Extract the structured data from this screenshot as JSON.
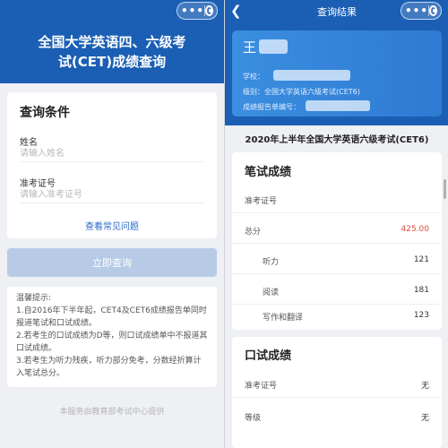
{
  "query_page": {
    "title_line1": "全国大学英语四、六级考",
    "title_line2": "试(CET)成绩查询",
    "section_title": "查询条件",
    "name_label": "姓名",
    "name_placeholder": "请输入姓名",
    "id_label": "准考证号",
    "id_placeholder": "请输入准考证号",
    "faq_link": "查看常见问题",
    "query_button": "立即查询",
    "tips": {
      "heading": "温馨提示:",
      "item1": "1.自2016年下半年起，CET4及CET6成绩报告单同时报道笔试和口试成绩。",
      "item2": "2.若考生的口试成绩为D等，则口试成绩单中不报道其口试成绩。",
      "item3": "3.若考生为听力残疾，听力部分免考，分数经折算计入笔试总分。"
    },
    "footer": "本服务由教育部考试中心提供"
  },
  "result_page": {
    "nav_title": "查询结果",
    "back_icon": "chevron-left",
    "name": "王",
    "school_label": "学校：",
    "level": "级别：全国大学英语六级考试(CET6)",
    "report_label": "成绩报告单编号：",
    "exam_title": "2020年上半年全国大学英语六级考试(CET6)",
    "written": {
      "title": "笔试成绩",
      "id_label": "准考证号",
      "total_label": "总分",
      "total_value": "425.00",
      "listening_label": "听力",
      "listening_value": "121",
      "reading_label": "阅读",
      "reading_value": "181",
      "writing_label": "写作和翻译",
      "writing_value": "123"
    },
    "oral": {
      "title": "口试成绩",
      "id_label": "准考证号",
      "id_value": "无",
      "grade_label": "等级",
      "grade_value": "无"
    }
  },
  "capsule": {
    "dots": "•••"
  },
  "colors": {
    "brand": "#1a5fb4",
    "accent_red": "#e04b3b",
    "link": "#2a68c9"
  }
}
